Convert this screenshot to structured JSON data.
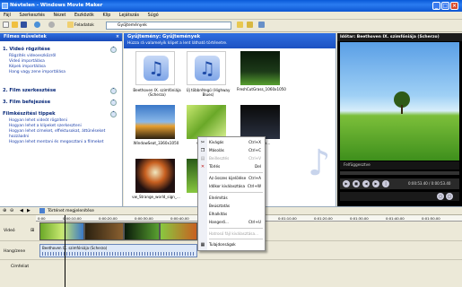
{
  "window": {
    "title": "Névtelen - Windows Movie Maker"
  },
  "menu": [
    "Fájl",
    "Szerkesztés",
    "Nézet",
    "Eszközök",
    "Klip",
    "Lejátszás",
    "Súgó"
  ],
  "toolbar": {
    "tasks_label": "Feladatok",
    "collections_label": "Gyűjtemények",
    "address_value": "Gyűjtemények"
  },
  "tasks_pane": {
    "title": "Filmes műveletek",
    "sections": [
      {
        "title": "1. Videó rögzítése",
        "items": [
          "Rögzítés videoeszközről",
          "Videó importálása",
          "Képek importálása",
          "Hang vagy zene importálása"
        ]
      },
      {
        "title": "2. Film szerkesztése",
        "items": []
      },
      {
        "title": "3. Film befejezése",
        "items": []
      },
      {
        "title": "Filmkészítési tippek",
        "items": [
          "Hogyan lehet videót rögzíteni",
          "Hogyan lehet a klipeket szerkeszteni",
          "Hogyan lehet címeket, effektusokat, áttűnéseket hozzáadni",
          "Hogyan lehet mentani és megosztani a filmeket"
        ]
      }
    ]
  },
  "collection": {
    "title": "Gyűjtemény: Gyűjtemények",
    "subtitle": "Húzza rá valamelyik klipet a lent látható történetre.",
    "items": [
      {
        "label": "Beethoven IX. szimfóniája (Scherzo)",
        "kind": "music"
      },
      {
        "label": "Új többrétegű (Highway Blues)",
        "kind": "music"
      },
      {
        "label": "FreshCutGrass_1060x1050",
        "kind": "grass"
      },
      {
        "label": "WindowSeat_3360x1050",
        "kind": "sunset"
      },
      {
        "label": "vw_Green...",
        "kind": "leaf"
      },
      {
        "label": "...3360x...",
        "kind": "dark"
      },
      {
        "label": "vw_Strange_world_sign_...",
        "kind": "space"
      },
      {
        "label": "vw_The_...",
        "kind": "green"
      }
    ]
  },
  "context_menu": [
    {
      "label": "Kivágás",
      "shortcut": "Ctrl+X",
      "icon": "cut-icon",
      "disabled": false
    },
    {
      "label": "Másolás",
      "shortcut": "Ctrl+C",
      "icon": "copy-icon",
      "disabled": false
    },
    {
      "label": "Beillesztés",
      "shortcut": "Ctrl+V",
      "icon": "paste-icon",
      "disabled": true
    },
    {
      "label": "Törlés",
      "shortcut": "Del",
      "icon": "delete-icon",
      "disabled": false
    },
    {
      "label": "Az összes kijelölése",
      "shortcut": "Ctrl+A",
      "icon": "",
      "disabled": false
    },
    {
      "label": "Időkor kiválasztása",
      "shortcut": "Ctrl+W",
      "icon": "",
      "disabled": false
    },
    {
      "label": "Elnémítás",
      "shortcut": "",
      "icon": "",
      "disabled": false
    },
    {
      "label": "Beúsztatás",
      "shortcut": "",
      "icon": "",
      "disabled": false
    },
    {
      "label": "Elhalkítás",
      "shortcut": "",
      "icon": "",
      "disabled": false
    },
    {
      "label": "Hangerő...",
      "shortcut": "Ctrl+U",
      "icon": "",
      "disabled": false
    },
    {
      "label": "Hatrosó fájl kiválasztása...",
      "shortcut": "",
      "icon": "",
      "disabled": true
    },
    {
      "label": "Tulajdonságok",
      "shortcut": "",
      "icon": "",
      "disabled": false
    }
  ],
  "preview": {
    "title": "Időtar: Beethoven IX. szimfóniája (Scherzo)",
    "status": "Felfüggesztve",
    "time": "0:00:53.40 / 0:00:53.40"
  },
  "timeline": {
    "show_storyboard": "Történet megjelenítése",
    "ruler": [
      "0:00",
      "0:00:10.00",
      "0:00:20.00",
      "0:00:30.00",
      "0:00:40.00",
      "0:00:50.00",
      "0:01:00.00",
      "0:01:10.00",
      "0:01:20.00",
      "0:01:30.00",
      "0:01:40.00",
      "0:01:50.00"
    ],
    "tracks": {
      "video": "Videó",
      "audio": "Hang/zene",
      "titles": "Címfeliat"
    },
    "video_clip_label": "vw_Tradition...",
    "audio_clip_label": "Beethoven IX. szimfóniája (Scherzo)"
  }
}
